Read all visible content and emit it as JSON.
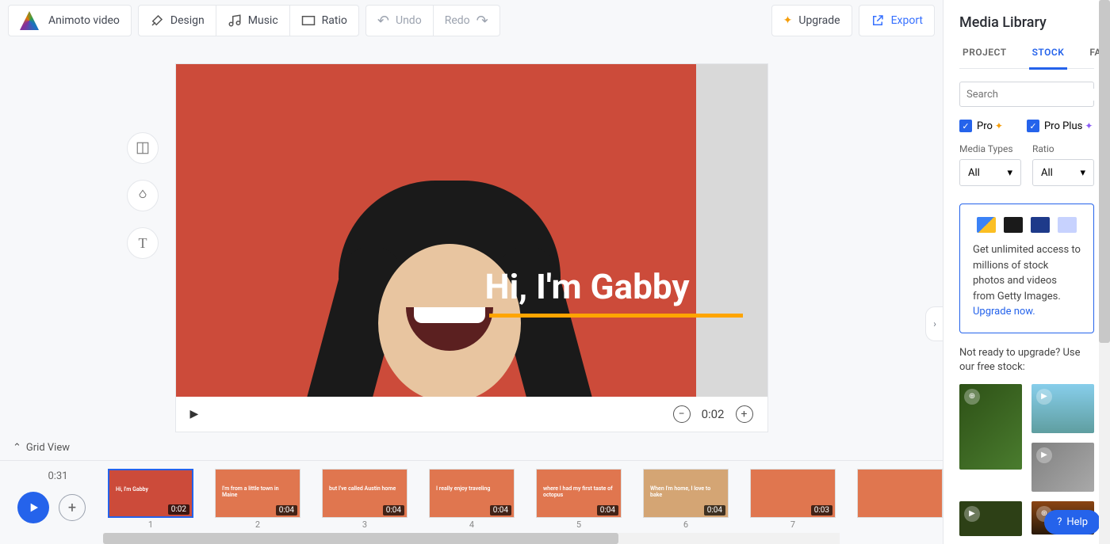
{
  "toolbar": {
    "video_name": "Animoto video",
    "design": "Design",
    "music": "Music",
    "ratio": "Ratio",
    "undo": "Undo",
    "redo": "Redo",
    "upgrade": "Upgrade",
    "export": "Export"
  },
  "canvas": {
    "overlay_text": "Hi, I'm Gabby",
    "current_time": "0:02"
  },
  "grid_view_label": "Grid View",
  "timeline": {
    "total": "0:31",
    "clips": [
      {
        "num": "1",
        "dur": "0:02",
        "text": "Hi, I'm Gabby",
        "active": true
      },
      {
        "num": "2",
        "dur": "0:04",
        "text": "I'm from a little town in Maine"
      },
      {
        "num": "3",
        "dur": "0:04",
        "text": "but I've called Austin home"
      },
      {
        "num": "4",
        "dur": "0:04",
        "text": "I really enjoy traveling"
      },
      {
        "num": "5",
        "dur": "0:04",
        "text": "where I had my first taste of octopus"
      },
      {
        "num": "6",
        "dur": "0:04",
        "text": "When I'm home, I love to bake"
      },
      {
        "num": "7",
        "dur": "0:03",
        "text": ""
      },
      {
        "num": "",
        "dur": "",
        "text": ""
      }
    ]
  },
  "panel": {
    "title": "Media Library",
    "tabs": {
      "project": "PROJECT",
      "stock": "STOCK",
      "favorites": "FAVORITES"
    },
    "search_placeholder": "Search",
    "pro": "Pro",
    "pro_plus": "Pro Plus",
    "media_types_label": "Media Types",
    "ratio_label": "Ratio",
    "all": "All",
    "promo_text": "Get unlimited access to millions of stock photos and videos from Getty Images. ",
    "promo_link": "Upgrade now.",
    "free_text": "Not ready to upgrade? Use our free stock:"
  },
  "help": "Help"
}
